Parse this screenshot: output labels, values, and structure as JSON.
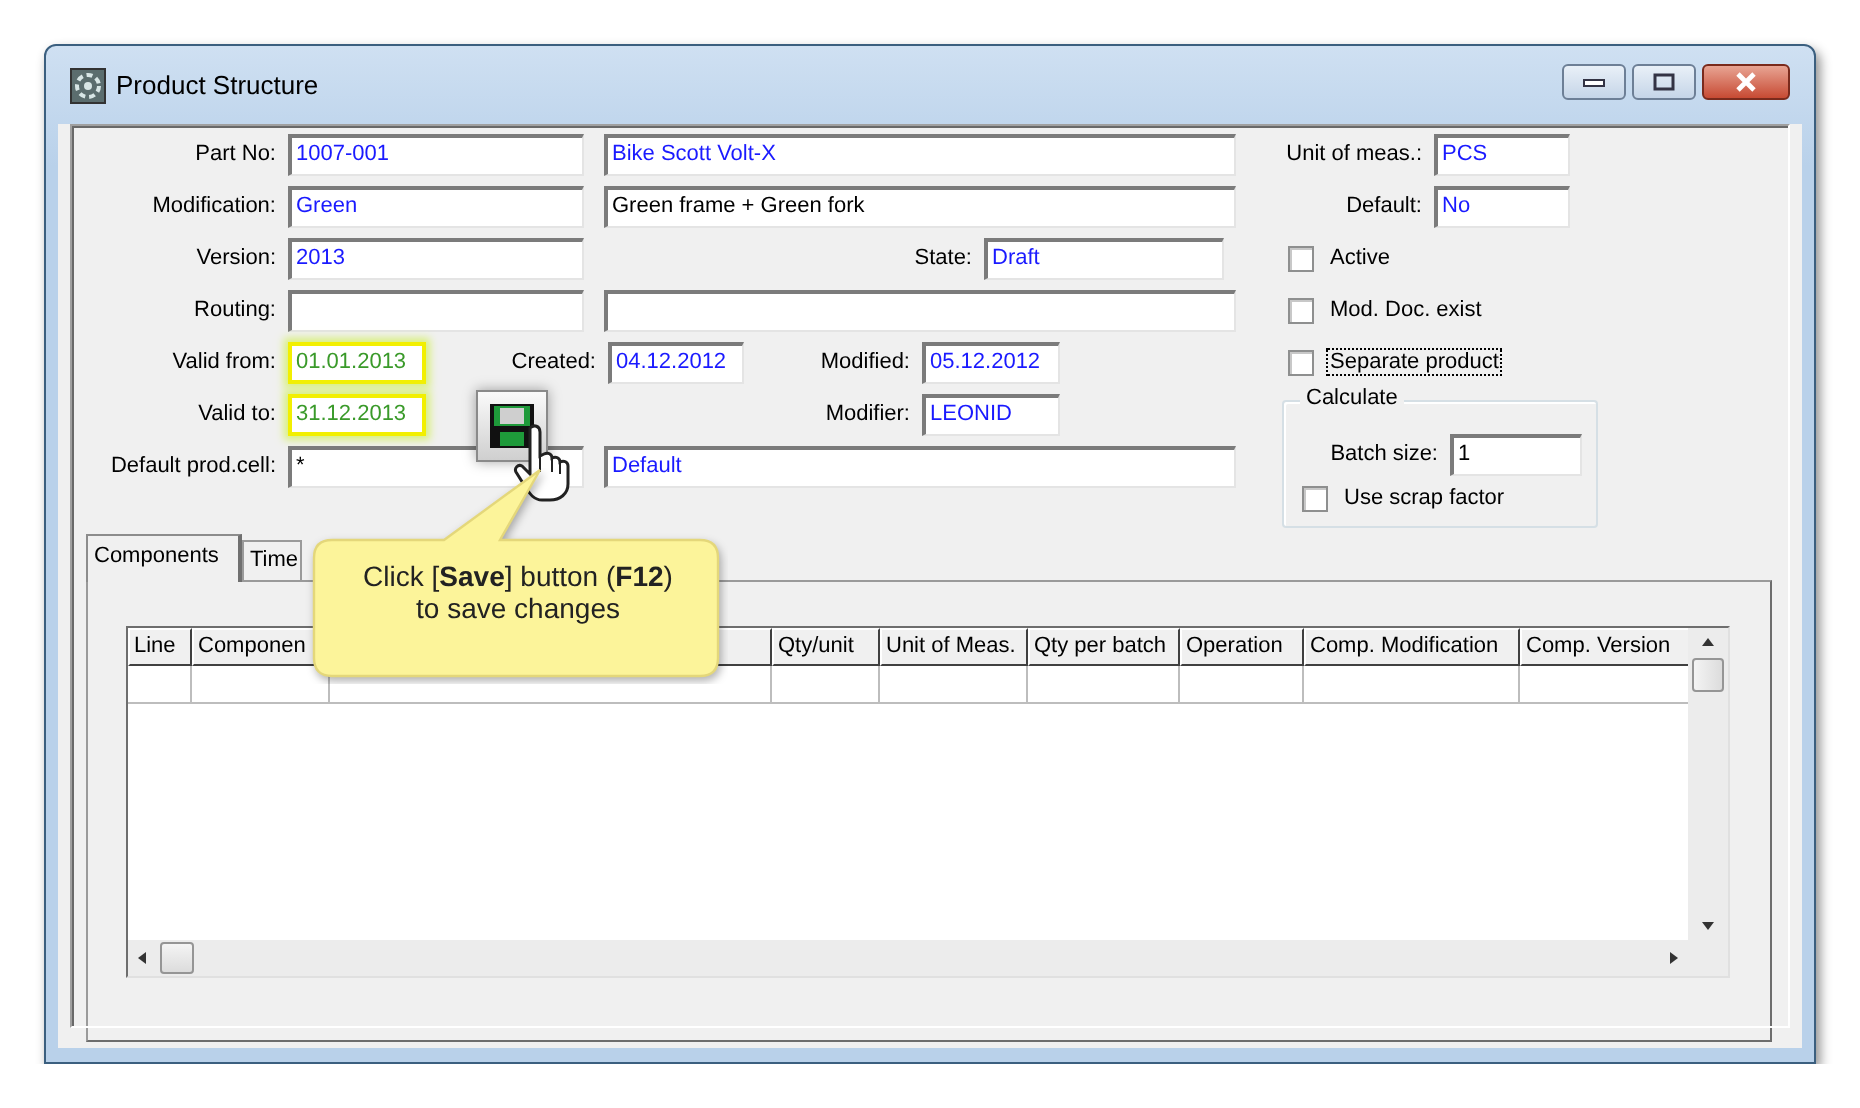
{
  "window": {
    "title": "Product Structure"
  },
  "form": {
    "part_no": {
      "label": "Part No:",
      "value": "1007-001"
    },
    "part_description": {
      "value": "Bike Scott Volt-X"
    },
    "modification": {
      "label": "Modification:",
      "value": "Green"
    },
    "modification_description": {
      "value": "Green frame + Green fork"
    },
    "version": {
      "label": "Version:",
      "value": "2013"
    },
    "state": {
      "label": "State:",
      "value": "Draft"
    },
    "routing": {
      "label": "Routing:"
    },
    "valid_from": {
      "label": "Valid from:",
      "value": "01.01.2013",
      "highlighted": true
    },
    "created": {
      "label": "Created:",
      "value": "04.12.2012"
    },
    "modified": {
      "label": "Modified:",
      "value": "05.12.2012"
    },
    "valid_to": {
      "label": "Valid to:",
      "value": "31.12.2013",
      "highlighted": true
    },
    "modifier": {
      "label": "Modifier:",
      "value": "LEONID"
    },
    "default_prod_cell": {
      "label": "Default prod.cell:",
      "value": "*"
    },
    "prod_cell_description": {
      "value": "Default"
    },
    "unit_of_meas": {
      "label": "Unit of meas.:",
      "value": "PCS"
    },
    "default": {
      "label": "Default:",
      "value": "No"
    }
  },
  "checkboxes": [
    {
      "label": "Active",
      "checked": false,
      "focused": false
    },
    {
      "label": "Mod. Doc. exist",
      "checked": false,
      "focused": false
    },
    {
      "label": "Separate product",
      "checked": false,
      "focused": true
    }
  ],
  "calculate": {
    "title": "Calculate",
    "batch_size": {
      "label": "Batch size:",
      "value": "1"
    },
    "use_scrap_factor": {
      "label": "Use scrap factor",
      "checked": false
    }
  },
  "tabs": [
    {
      "label": "Components",
      "selected": true
    },
    {
      "label": "Time",
      "selected": false
    }
  ],
  "grid": {
    "columns": [
      "Line",
      "Componen",
      null,
      "Qty/unit",
      "Unit of Meas.",
      "Qty per batch",
      "Operation",
      "Comp. Modification",
      "Comp. Version"
    ]
  },
  "callout": {
    "text": "Click [**Save**] button (**F12**) to save changes"
  }
}
